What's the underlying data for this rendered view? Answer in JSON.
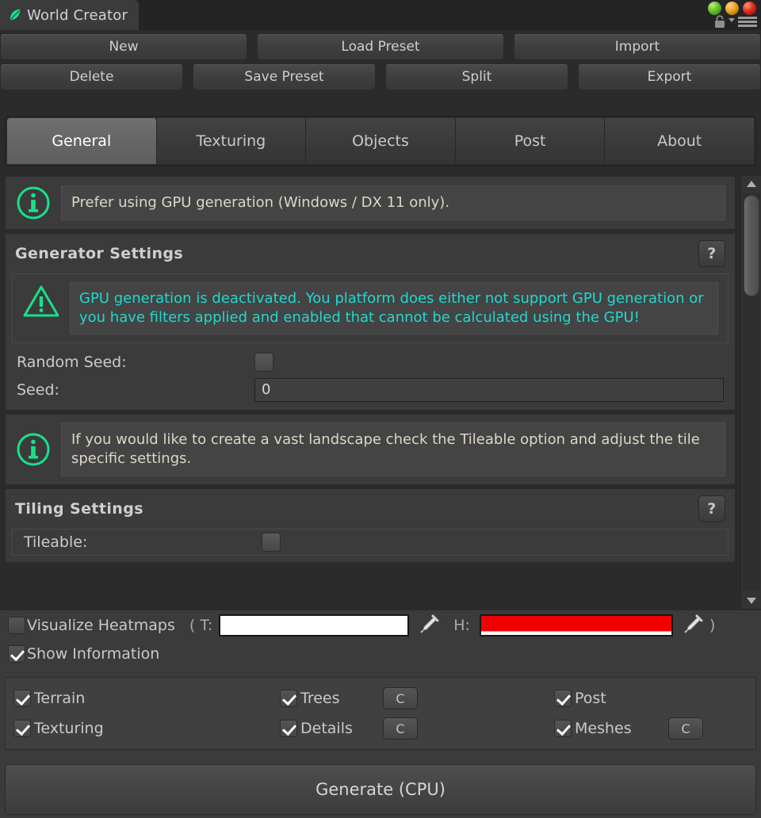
{
  "window": {
    "title": "World Creator",
    "icon": "leaf-icon",
    "controls": {
      "orbs": [
        "green",
        "orange",
        "red"
      ],
      "lock": "lock-icon",
      "menu": "hamburger-menu-icon"
    }
  },
  "toolbar": {
    "row1": [
      "New",
      "Load Preset",
      "Import"
    ],
    "row2": [
      "Delete",
      "Save Preset",
      "Split",
      "Export"
    ]
  },
  "tabs": [
    {
      "label": "General",
      "active": true
    },
    {
      "label": "Texturing",
      "active": false
    },
    {
      "label": "Objects",
      "active": false
    },
    {
      "label": "Post",
      "active": false
    },
    {
      "label": "About",
      "active": false
    }
  ],
  "content": {
    "info_top": {
      "icon": "info-icon",
      "text": "Prefer using GPU generation (Windows / DX 11 only)."
    },
    "generator_settings": {
      "title": "Generator Settings",
      "help_label": "?",
      "warning": {
        "icon": "warning-icon",
        "text": "GPU generation is deactivated. You platform does either not support GPU generation or you have filters applied and enabled that cannot be calculated using the GPU!"
      },
      "random_seed_label": "Random Seed:",
      "random_seed_checked": false,
      "seed_label": "Seed:",
      "seed_value": "0"
    },
    "info_tiling": {
      "icon": "info-icon",
      "text": "If you would like to create a vast landscape check the Tileable option and adjust the tile specific settings."
    },
    "tiling_settings": {
      "title": "Tiling Settings",
      "help_label": "?",
      "tileable_label": "Tileable:",
      "tileable_checked": false
    }
  },
  "scrollbar": {
    "up_arrow": "chevron-up-icon",
    "down_arrow": "chevron-down-icon"
  },
  "bottom": {
    "visualize_heatmaps": {
      "label": "Visualize Heatmaps",
      "checked": false
    },
    "show_information": {
      "label": "Show Information",
      "checked": true
    },
    "open_paren": "(",
    "close_paren": ")",
    "t_label": "T:",
    "h_label": "H:",
    "t_color": "#ffffff",
    "h_color": "#f00000",
    "pipette_icon": "eyedropper-icon",
    "checks": [
      {
        "label": "Terrain",
        "checked": true,
        "c_button": null
      },
      {
        "label": "Texturing",
        "checked": true,
        "c_button": null
      },
      {
        "label": "Trees",
        "checked": true,
        "c_button": "C"
      },
      {
        "label": "Details",
        "checked": true,
        "c_button": "C"
      },
      {
        "label": "Post",
        "checked": true,
        "c_button": null
      },
      {
        "label": "Meshes",
        "checked": true,
        "c_button": "C"
      }
    ],
    "generate_button": "Generate (CPU)"
  },
  "colors": {
    "accent_green": "#18e08a",
    "warning_text": "#21d8cf",
    "info_text": "#dcd7c6",
    "panel_bg": "#3b3b3b",
    "window_bg": "#2b2b2b"
  }
}
